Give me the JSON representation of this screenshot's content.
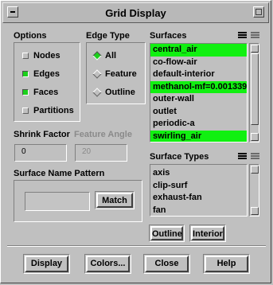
{
  "window": {
    "title": "Grid Display"
  },
  "options": {
    "heading": "Options",
    "items": [
      {
        "label": "Nodes",
        "checked": false
      },
      {
        "label": "Edges",
        "checked": true
      },
      {
        "label": "Faces",
        "checked": true
      },
      {
        "label": "Partitions",
        "checked": false
      }
    ]
  },
  "edge_type": {
    "heading": "Edge Type",
    "items": [
      {
        "label": "All",
        "selected": true
      },
      {
        "label": "Feature",
        "selected": false
      },
      {
        "label": "Outline",
        "selected": false
      }
    ]
  },
  "surfaces": {
    "heading": "Surfaces",
    "items": [
      {
        "label": "central_air",
        "selected": true
      },
      {
        "label": "co-flow-air",
        "selected": false
      },
      {
        "label": "default-interior",
        "selected": false
      },
      {
        "label": "methanol-mf=0.001339",
        "selected": true
      },
      {
        "label": "outer-wall",
        "selected": false
      },
      {
        "label": "outlet",
        "selected": false
      },
      {
        "label": "periodic-a",
        "selected": false
      },
      {
        "label": "swirling_air",
        "selected": true
      }
    ]
  },
  "surface_types": {
    "heading": "Surface Types",
    "items": [
      "axis",
      "clip-surf",
      "exhaust-fan",
      "fan"
    ],
    "outline_label": "Outline",
    "interior_label": "Interior"
  },
  "shrink": {
    "label": "Shrink Factor",
    "value": "0"
  },
  "feature_angle": {
    "label": "Feature Angle",
    "value": "20"
  },
  "pattern": {
    "label": "Surface Name Pattern",
    "value": "",
    "match_label": "Match"
  },
  "footer": {
    "display": "Display",
    "colors": "Colors...",
    "close": "Close",
    "help": "Help"
  }
}
